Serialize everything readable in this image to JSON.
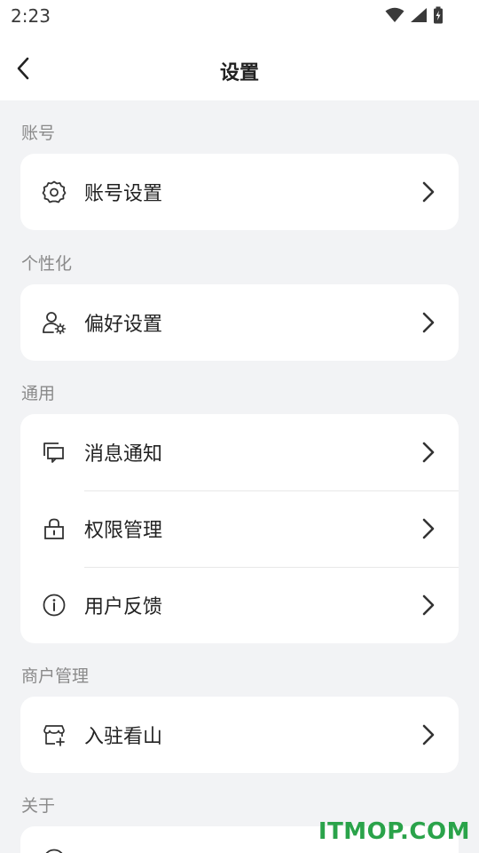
{
  "status_bar": {
    "time": "2:23",
    "icons": [
      "wifi-icon",
      "signal-icon",
      "battery-icon"
    ]
  },
  "nav": {
    "title": "设置"
  },
  "sections": [
    {
      "title": "账号",
      "items": [
        {
          "label": "账号设置",
          "icon": "gear-icon"
        }
      ]
    },
    {
      "title": "个性化",
      "items": [
        {
          "label": "偏好设置",
          "icon": "user-preference-icon"
        }
      ]
    },
    {
      "title": "通用",
      "items": [
        {
          "label": "消息通知",
          "icon": "message-icon"
        },
        {
          "label": "权限管理",
          "icon": "lock-icon"
        },
        {
          "label": "用户反馈",
          "icon": "info-icon"
        }
      ]
    },
    {
      "title": "商户管理",
      "items": [
        {
          "label": "入驻看山",
          "icon": "store-add-icon"
        }
      ]
    },
    {
      "title": "关于",
      "items": []
    }
  ],
  "watermark": "ITMOP.COM",
  "colors": {
    "background": "#f2f3f5",
    "card": "#ffffff",
    "watermark": "#2aa34a"
  }
}
